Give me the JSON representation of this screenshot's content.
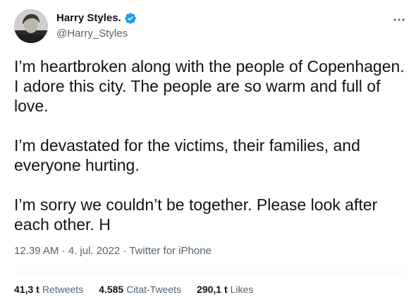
{
  "author": {
    "display_name": "Harry Styles.",
    "handle": "@Harry_Styles",
    "verified": true,
    "verified_color": "#1d9bf0"
  },
  "tweet": {
    "paragraphs": [
      "I’m heartbroken along with the people of Copenhagen. I adore this city. The people are so warm and full of love.",
      "I’m devastated for the victims, their families, and everyone hurting.",
      "I’m sorry we couldn’t be together. Please look after each other. H"
    ],
    "time": "12.39 AM",
    "date": "4. jul. 2022",
    "separator": "·",
    "source": "Twitter for iPhone"
  },
  "stats": {
    "retweets": {
      "value": "41,3 t",
      "label": "Retweets"
    },
    "quotes": {
      "value": "4.585",
      "label": "Citat-Tweets"
    },
    "likes": {
      "value": "290,1 t",
      "label": "Likes"
    }
  },
  "icons": {
    "more": "more-dots-icon",
    "verified": "verified-badge-icon"
  }
}
